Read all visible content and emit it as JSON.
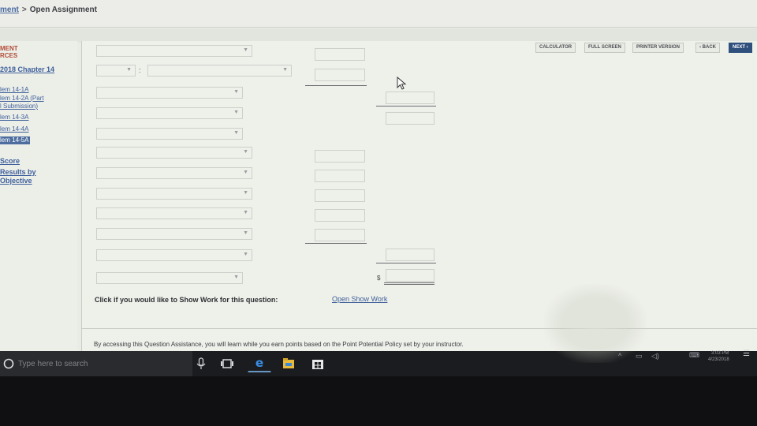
{
  "breadcrumb": {
    "prev": "ment",
    "separator": ">",
    "current": "Open Assignment"
  },
  "sidebar": {
    "heading_1": "MENT",
    "heading_2": "RCES",
    "chapter": "2018 Chapter 14",
    "items": [
      "lem 14-1A",
      "lem 14-2A (Part",
      "l Submission)",
      "lem 14-3A",
      "lem 14-4A",
      "lem 14-5A"
    ],
    "active_item": "lem 14-5A",
    "score": "Score",
    "results_1": "Results by",
    "results_2": "Objective"
  },
  "toolbar": {
    "calculator": "CALCULATOR",
    "full_screen": "FULL SCREEN",
    "printer_version": "PRINTER VERSION",
    "back": "‹ BACK",
    "next": "NEXT ›"
  },
  "form": {
    "colon": ":",
    "dollar": "$",
    "show_work_label": "Click if you would like to Show Work for this question:",
    "show_work_link": "Open Show Work"
  },
  "footer": {
    "notice": "By accessing this Question Assistance, you will learn while you earn points based on the Point Potential Policy set by your instructor."
  },
  "taskbar": {
    "search_placeholder": "Type here to search",
    "time": "3:03 PM",
    "date": "4/23/2018",
    "icons": [
      "cortana-mic-icon",
      "task-view-icon",
      "edge-icon",
      "file-explorer-icon",
      "store-icon"
    ]
  }
}
